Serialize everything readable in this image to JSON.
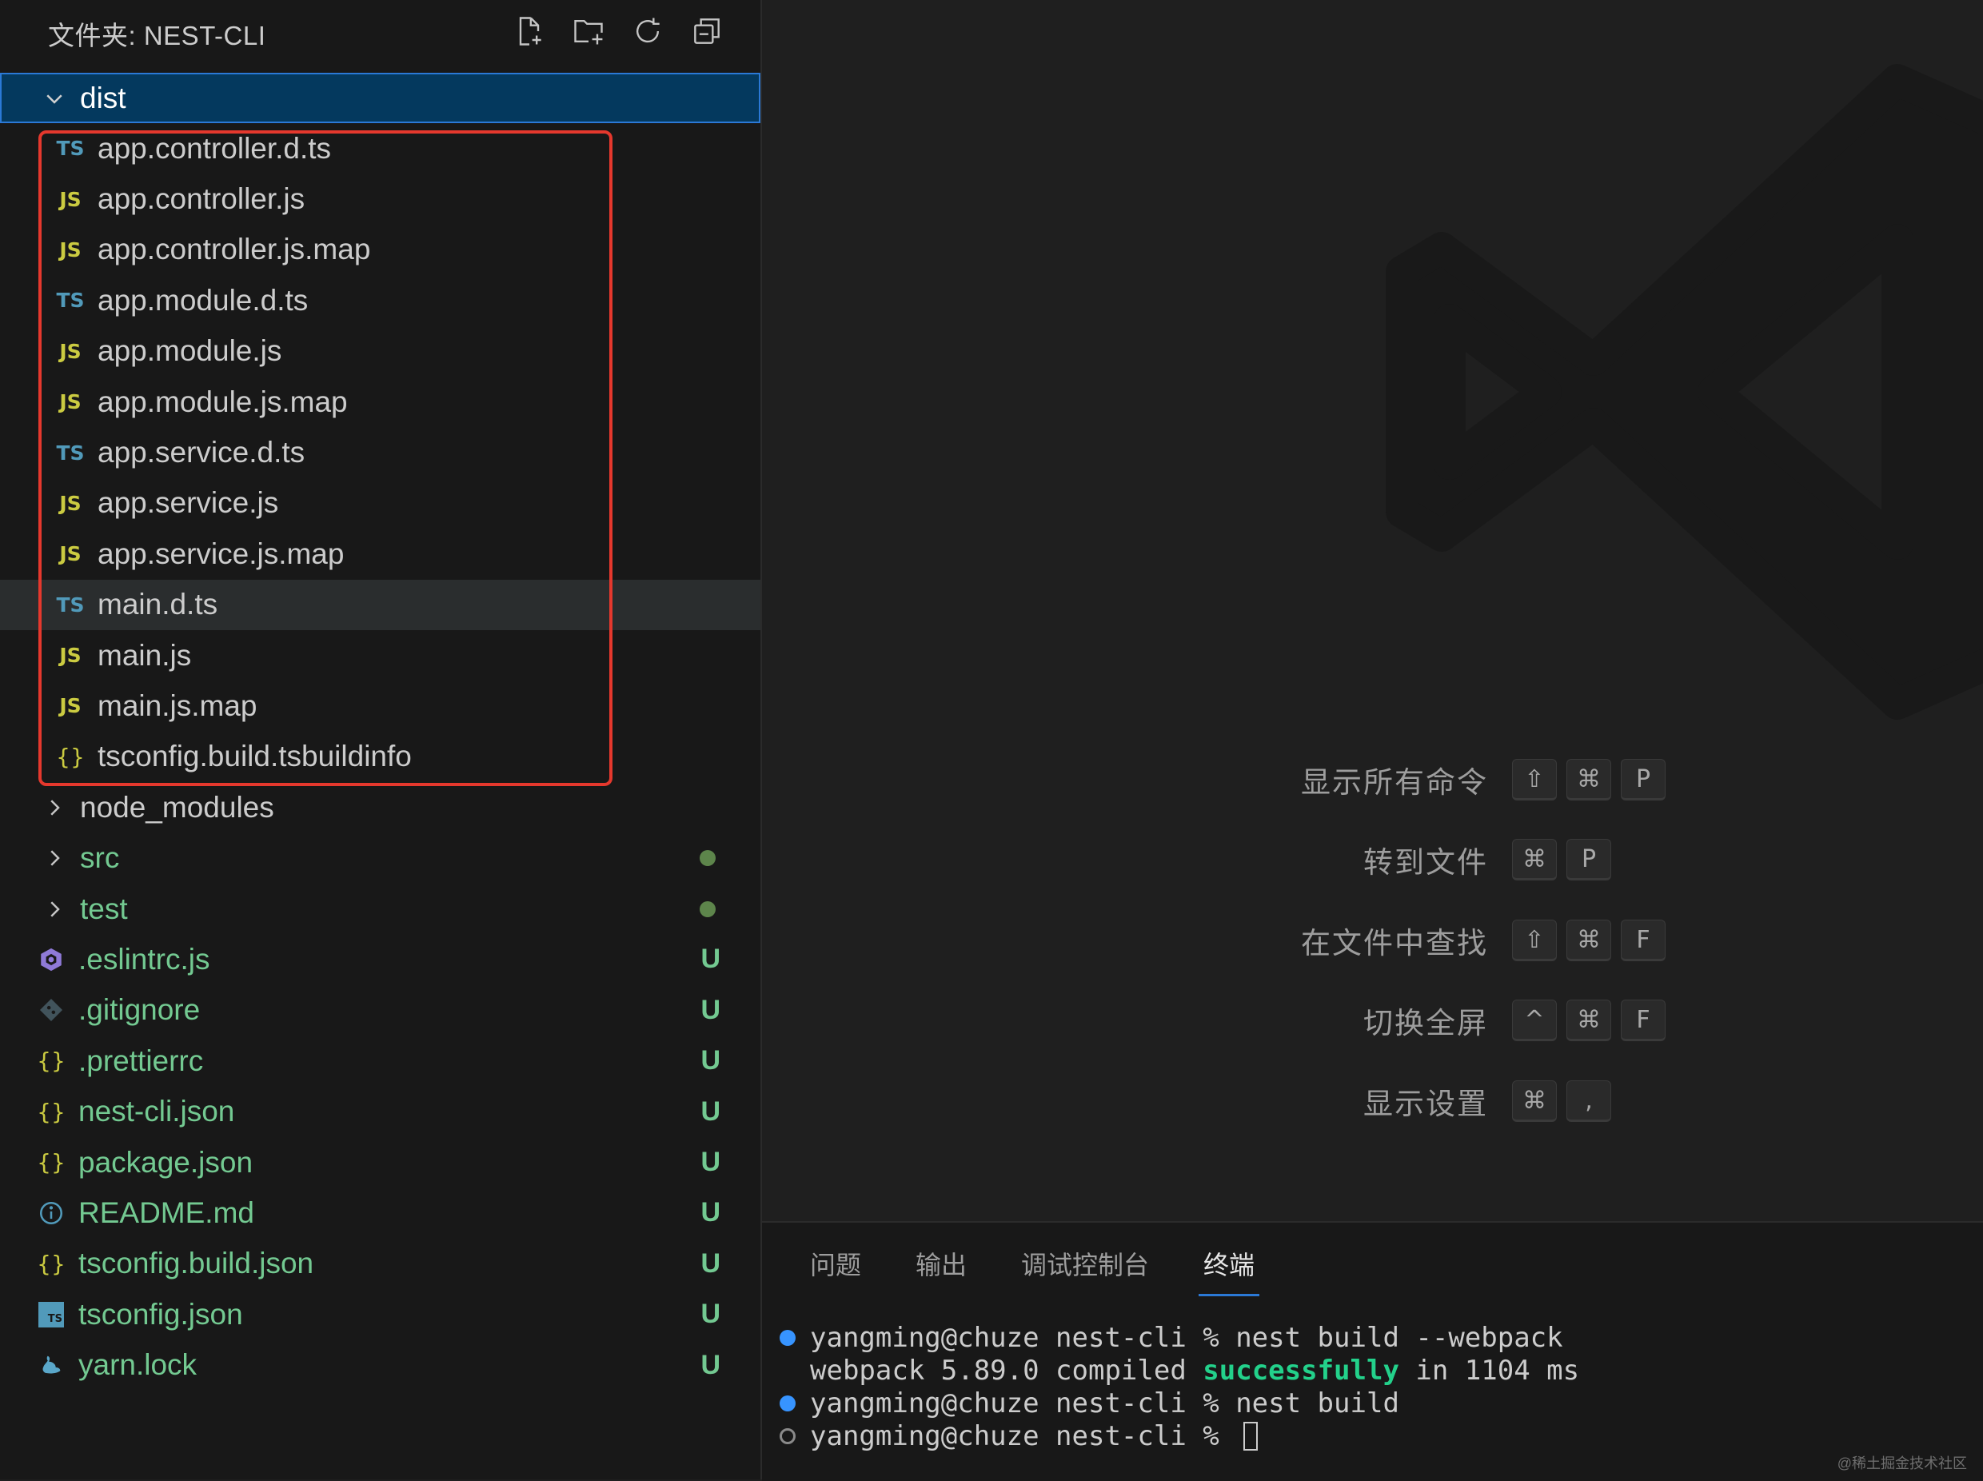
{
  "explorer": {
    "title": "文件夹: NEST-CLI",
    "actions": [
      "new-file",
      "new-folder",
      "refresh",
      "collapse-all"
    ],
    "open_folder": "dist",
    "dist_files": [
      {
        "type": "ts",
        "icon": "TS",
        "name": "app.controller.d.ts"
      },
      {
        "type": "js",
        "icon": "JS",
        "name": "app.controller.js"
      },
      {
        "type": "js",
        "icon": "JS",
        "name": "app.controller.js.map"
      },
      {
        "type": "ts",
        "icon": "TS",
        "name": "app.module.d.ts"
      },
      {
        "type": "js",
        "icon": "JS",
        "name": "app.module.js"
      },
      {
        "type": "js",
        "icon": "JS",
        "name": "app.module.js.map"
      },
      {
        "type": "ts",
        "icon": "TS",
        "name": "app.service.d.ts"
      },
      {
        "type": "js",
        "icon": "JS",
        "name": "app.service.js"
      },
      {
        "type": "js",
        "icon": "JS",
        "name": "app.service.js.map"
      },
      {
        "type": "ts",
        "icon": "TS",
        "name": "main.d.ts"
      },
      {
        "type": "js",
        "icon": "JS",
        "name": "main.js"
      },
      {
        "type": "js",
        "icon": "JS",
        "name": "main.js.map"
      },
      {
        "type": "json",
        "icon": "{}",
        "name": "tsconfig.build.tsbuildinfo"
      }
    ],
    "folders": [
      {
        "name": "node_modules",
        "status": ""
      },
      {
        "name": "src",
        "status": "dot"
      },
      {
        "name": "test",
        "status": "dot"
      }
    ],
    "root_files": [
      {
        "type": "eslint",
        "name": ".eslintrc.js",
        "badge": "U"
      },
      {
        "type": "git",
        "name": ".gitignore",
        "badge": "U"
      },
      {
        "type": "json",
        "name": ".prettierrc",
        "badge": "U"
      },
      {
        "type": "json",
        "name": "nest-cli.json",
        "badge": "U"
      },
      {
        "type": "json",
        "name": "package.json",
        "badge": "U"
      },
      {
        "type": "info",
        "name": "README.md",
        "badge": "U"
      },
      {
        "type": "json",
        "name": "tsconfig.build.json",
        "badge": "U"
      },
      {
        "type": "tsconfig",
        "name": "tsconfig.json",
        "badge": "U"
      },
      {
        "type": "yarn",
        "name": "yarn.lock",
        "badge": "U"
      }
    ],
    "json_icon_glyph": "{}",
    "ts_box_glyph": "TS"
  },
  "shortcuts": [
    {
      "label": "显示所有命令",
      "keys": [
        "⇧",
        "⌘",
        "P"
      ]
    },
    {
      "label": "转到文件",
      "keys": [
        "⌘",
        "P"
      ]
    },
    {
      "label": "在文件中查找",
      "keys": [
        "⇧",
        "⌘",
        "F"
      ]
    },
    {
      "label": "切换全屏",
      "keys": [
        "^",
        "⌘",
        "F"
      ]
    },
    {
      "label": "显示设置",
      "keys": [
        "⌘",
        ","
      ]
    }
  ],
  "panel": {
    "tabs": [
      "问题",
      "输出",
      "调试控制台",
      "终端"
    ],
    "active_tab": "终端"
  },
  "terminal": {
    "line1": "yangming@chuze nest-cli % nest build --webpack",
    "line2_pre": "webpack 5.89.0 compiled ",
    "line2_success": "successfully",
    "line2_post": " in 1104 ms",
    "line3": "yangming@chuze nest-cli % nest build",
    "line4": "yangming@chuze nest-cli % "
  },
  "corner_mark": "@稀土掘金技术社区",
  "colors": {
    "accent": "#2b79d6",
    "untracked": "#73c991",
    "highlight_box": "#e5382d",
    "ts_icon": "#519aba",
    "js_icon": "#cbcb41"
  }
}
